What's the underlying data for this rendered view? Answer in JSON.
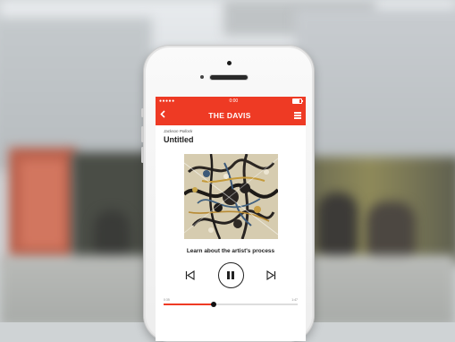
{
  "status_bar": {
    "signal": "●●●●● ",
    "time": "0:00"
  },
  "nav": {
    "back_icon": "chevron-left-icon",
    "title": "THE DAVIS",
    "menu_icon": "hamburger-menu-icon"
  },
  "track": {
    "artist": "Jackson Pollock",
    "title": "Untitled"
  },
  "prompt": "Learn about the artist's process",
  "player": {
    "prev_icon": "skip-back-icon",
    "pause_icon": "pause-icon",
    "next_icon": "skip-forward-icon",
    "elapsed": "0:35",
    "duration": "1:47",
    "progress": 0.37
  },
  "colors": {
    "accent": "#ee3a24"
  }
}
